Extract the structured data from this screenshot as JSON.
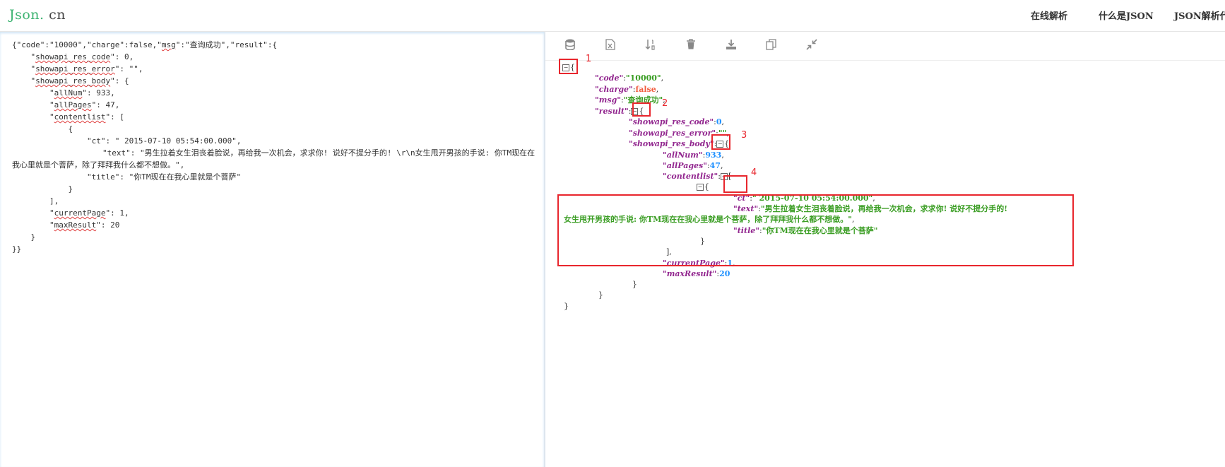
{
  "header": {
    "logo_main": "Json.",
    "logo_sub": " cn",
    "nav": [
      "在线解析",
      "什么是JSON",
      "JSON解析代码"
    ]
  },
  "toolbar": {
    "icons": [
      "database-icon",
      "excel-icon",
      "sort-icon",
      "trash-icon",
      "download-icon",
      "copy-icon",
      "compress-icon"
    ]
  },
  "raw": {
    "line1_a": "{\"code\":\"10000\",\"charge\":false,\"",
    "line1_msg": "msg",
    "line1_b": "\":\"查询成功\",\"result\":{",
    "l_res_code_key": "showapi_res_code",
    "l_res_code_val": ": 0,",
    "l_res_error_key": "showapi_res_error",
    "l_res_error_val": ": \"\",",
    "l_res_body_key": "showapi_res_body",
    "l_res_body_val": ": {",
    "l_allnum_key": "allNum",
    "l_allnum_val": ": 933,",
    "l_allpages_key": "allPages",
    "l_allpages_val": ": 47,",
    "l_contentlist_key": "contentlist",
    "l_contentlist_val": ": [",
    "l_open_obj": "{",
    "l_ct": "\"ct\": \" 2015-07-10 05:54:00.000\",",
    "l_text": "\"text\": \"男生拉着女生泪丧着脸说，再给我一次机会，求求你! 说好不提分手的! \\r\\n女生甩开男孩的手说: 你TM现在在我心里就是个菩萨，除了拜拜我什么都不想做。\",",
    "l_title": "\"title\": \"你TM现在在我心里就是个菩萨\"",
    "l_close_obj": "}",
    "l_close_arr": "],",
    "l_currentpage_key": "currentPage",
    "l_currentpage_val": ": 1,",
    "l_maxresult_key": "maxResult",
    "l_maxresult_val": ": 20",
    "l_close_body": "}",
    "l_close_all": "}}"
  },
  "tree": {
    "code_key": "\"code\"",
    "code_val": "\"10000\"",
    "charge_key": "\"charge\"",
    "charge_val": "false",
    "msg_key": "\"msg\"",
    "msg_val": "\"查询成功\"",
    "result_key": "\"result\"",
    "res_code_key": "\"showapi_res_code\"",
    "res_code_val": "0",
    "res_error_key": "\"showapi_res_error\"",
    "res_error_val": "\"\"",
    "res_body_key": "\"showapi_res_body\"",
    "allnum_key": "\"allNum\"",
    "allnum_val": "933",
    "allpages_key": "\"allPages\"",
    "allpages_val": "47",
    "contentlist_key": "\"contentlist\"",
    "ct_key": "\"ct\"",
    "ct_val": "\" 2015-07-10 05:54:00.000\"",
    "text_key": "\"text\"",
    "text_val_1": "\"男生拉着女生泪丧着脸说，再给我一次机会，求求你! 说好不提分手的!",
    "text_val_2": "女生甩开男孩的手说: 你TM现在在我心里就是个菩萨，除了拜拜我什么都不想做。\"",
    "title_key": "\"title\"",
    "title_val": "\"你TM现在在我心里就是个菩萨\"",
    "currentpage_key": "\"currentPage\"",
    "currentpage_val": "1",
    "maxresult_key": "\"maxResult\"",
    "maxresult_val": "20",
    "toggle_glyph": "−"
  },
  "annotations": {
    "labels": [
      "1",
      "2",
      "3",
      "4"
    ],
    "color": "#e8262d"
  },
  "colors": {
    "key": "#92278f",
    "string": "#3a9d23",
    "boolean": "#f25a3c",
    "number": "#1e90ff",
    "logo": "#3cb371"
  }
}
